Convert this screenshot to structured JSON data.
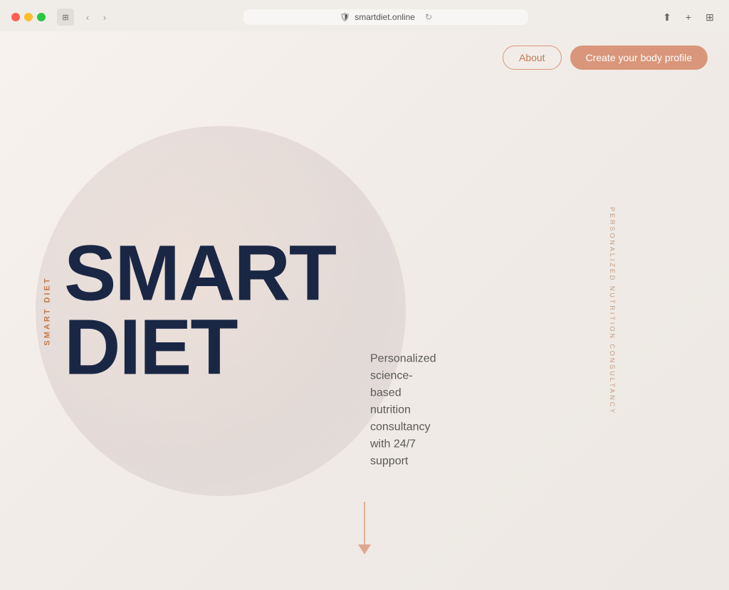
{
  "browser": {
    "url": "smartdiet.online",
    "security_icon": "🛡",
    "reload_icon": "↻"
  },
  "nav": {
    "about_label": "About",
    "cta_label": "Create your body profile"
  },
  "brand": {
    "name_vertical": "SMART DIET",
    "tagline_vertical": "PERSONALIZED NUTRITION CONSULTANCY"
  },
  "hero": {
    "line1": "SMART",
    "line2": "DIET",
    "tagline": "Personalized science-based nutrition consultancy with 24/7 support"
  },
  "colors": {
    "accent": "#d9967a",
    "dark_text": "#1a2744",
    "bg": "#f8f2ef"
  }
}
